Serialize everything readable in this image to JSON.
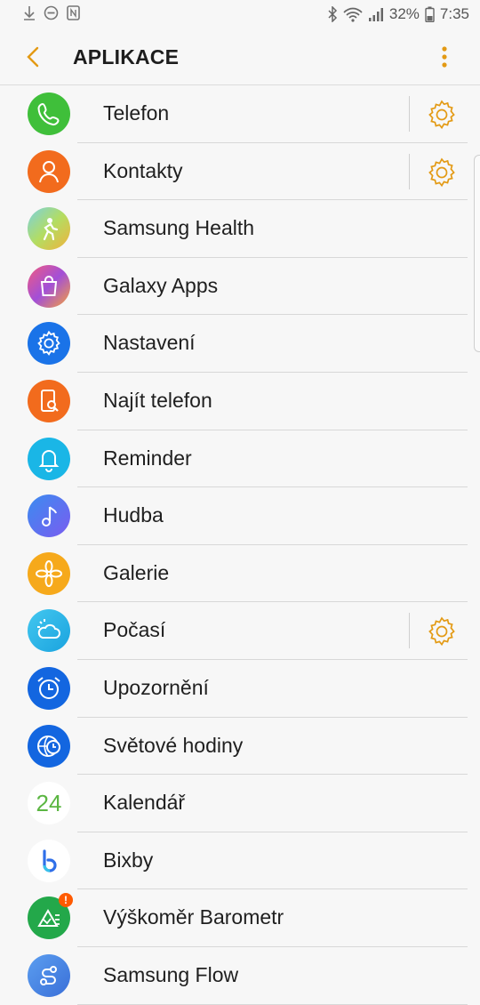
{
  "status": {
    "battery": "32%",
    "time": "7:35"
  },
  "header": {
    "title": "APLIKACE"
  },
  "colors": {
    "accent": "#e39a14"
  },
  "apps": [
    {
      "label": "Telefon",
      "icon": "phone-icon",
      "color": "#3fbf3a",
      "settings": true
    },
    {
      "label": "Kontakty",
      "icon": "contacts-icon",
      "color": "#f26b1d",
      "settings": true
    },
    {
      "label": "Samsung Health",
      "icon": "health-icon",
      "color": "#6fc6d8",
      "settings": false
    },
    {
      "label": "Galaxy Apps",
      "icon": "galaxy-apps-icon",
      "color": "#d64a9c",
      "settings": false
    },
    {
      "label": "Nastavení",
      "icon": "settings-app-icon",
      "color": "#1a73e8",
      "settings": false
    },
    {
      "label": "Najít telefon",
      "icon": "find-phone-icon",
      "color": "#f26b1d",
      "settings": false
    },
    {
      "label": "Reminder",
      "icon": "bell-icon",
      "color": "#1ab6e6",
      "settings": false
    },
    {
      "label": "Hudba",
      "icon": "music-icon",
      "color": "#5b6df0",
      "settings": false
    },
    {
      "label": "Galerie",
      "icon": "flower-icon",
      "color": "#f6a91b",
      "settings": false
    },
    {
      "label": "Počasí",
      "icon": "weather-icon",
      "color": "#2bb9e8",
      "settings": true
    },
    {
      "label": "Upozornění",
      "icon": "alarm-icon",
      "color": "#1366e0",
      "settings": false
    },
    {
      "label": "Světové hodiny",
      "icon": "world-clock-icon",
      "color": "#1366e0",
      "settings": false
    },
    {
      "label": "Kalendář",
      "icon": "calendar-icon",
      "color": "#ffffff",
      "settings": false,
      "number": "24"
    },
    {
      "label": "Bixby",
      "icon": "bixby-icon",
      "color": "#ffffff",
      "settings": false
    },
    {
      "label": "Výškoměr Barometr",
      "icon": "barometer-icon",
      "color": "#23a84a",
      "settings": false,
      "badge": "!"
    },
    {
      "label": "Samsung Flow",
      "icon": "flow-icon",
      "color": "#4a86e8",
      "settings": false
    }
  ]
}
